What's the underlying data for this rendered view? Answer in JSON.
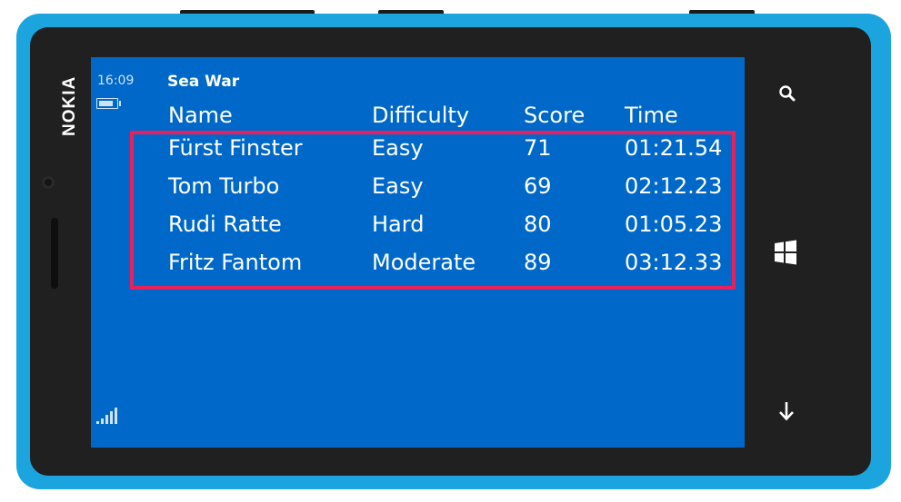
{
  "device": {
    "brand": "NOKIA",
    "body_color": "#1ba4dd",
    "bezel_color": "#202020"
  },
  "status_bar": {
    "time": "16:09",
    "battery_icon": "battery-icon",
    "signal_icon": "signal-strength-icon"
  },
  "app": {
    "title": "Sea War",
    "screen_color": "#0068c9",
    "highlight_color": "#ea1f5e"
  },
  "table": {
    "columns": [
      "Name",
      "Difficulty",
      "Score",
      "Time"
    ],
    "rows": [
      {
        "name": "Fürst Finster",
        "difficulty": "Easy",
        "score": "71",
        "time": "01:21.54"
      },
      {
        "name": "Tom Turbo",
        "difficulty": "Easy",
        "score": "69",
        "time": "02:12.23"
      },
      {
        "name": "Rudi Ratte",
        "difficulty": "Hard",
        "score": "80",
        "time": "01:05.23"
      },
      {
        "name": "Fritz Fantom",
        "difficulty": "Moderate",
        "score": "89",
        "time": "03:12.33"
      }
    ]
  },
  "hardware_buttons": {
    "search": "search-icon",
    "start": "windows-logo-icon",
    "back": "back-arrow-icon"
  }
}
